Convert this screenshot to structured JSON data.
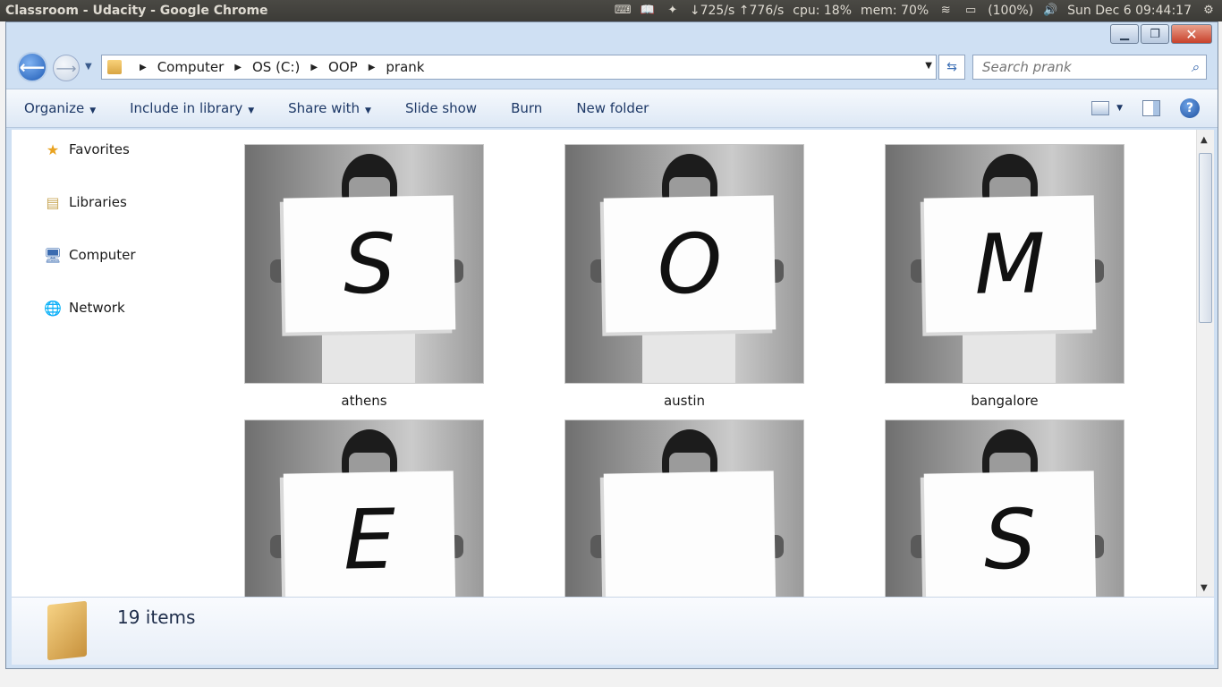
{
  "panel": {
    "title": "Classroom - Udacity - Google Chrome",
    "net": "↓725/s ↑776/s",
    "cpu": "cpu: 18%",
    "mem": "mem: 70%",
    "battery": "(100%)",
    "clock": "Sun Dec  6 09:44:17"
  },
  "address": {
    "crumbs": [
      "Computer",
      "OS (C:)",
      "OOP",
      "prank"
    ]
  },
  "search": {
    "placeholder": "Search prank"
  },
  "toolbar": {
    "organize": "Organize",
    "include": "Include in library",
    "share": "Share with",
    "slideshow": "Slide show",
    "burn": "Burn",
    "newfolder": "New folder"
  },
  "nav": {
    "favorites": "Favorites",
    "libraries": "Libraries",
    "computer": "Computer",
    "network": "Network"
  },
  "files": [
    {
      "name": "athens",
      "letter": "S"
    },
    {
      "name": "austin",
      "letter": "O"
    },
    {
      "name": "bangalore",
      "letter": "M"
    },
    {
      "name": "",
      "letter": "E"
    },
    {
      "name": "",
      "letter": ""
    },
    {
      "name": "",
      "letter": "S"
    }
  ],
  "status": {
    "count": "19 items"
  },
  "colors": {
    "accent": "#1e5bb5",
    "toolbar_text": "#1e3967"
  }
}
